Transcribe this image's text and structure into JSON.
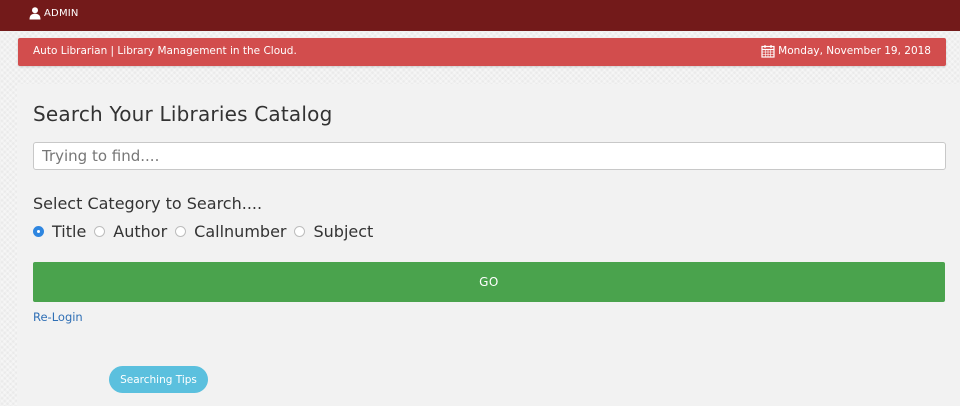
{
  "topbar": {
    "user_label": "ADMIN",
    "user_icon": "user-icon",
    "bg_color": "#731a1a"
  },
  "banner": {
    "left_text": "Auto Librarian | Library Management in the Cloud.",
    "date_icon": "calendar-icon",
    "date_text": "Monday, November 19, 2018",
    "bg_color": "#d24d4d"
  },
  "search": {
    "title": "Search Your Libraries Catalog",
    "placeholder": "Trying to find....",
    "value": "",
    "category_label": "Select Category to Search....",
    "categories": [
      {
        "label": "Title",
        "checked": true
      },
      {
        "label": "Author",
        "checked": false
      },
      {
        "label": "Callnumber",
        "checked": false
      },
      {
        "label": "Subject",
        "checked": false
      }
    ],
    "go_label": "GO",
    "go_color": "#4aa34d"
  },
  "links": {
    "relogin": "Re-Login",
    "tips": "Searching Tips"
  }
}
